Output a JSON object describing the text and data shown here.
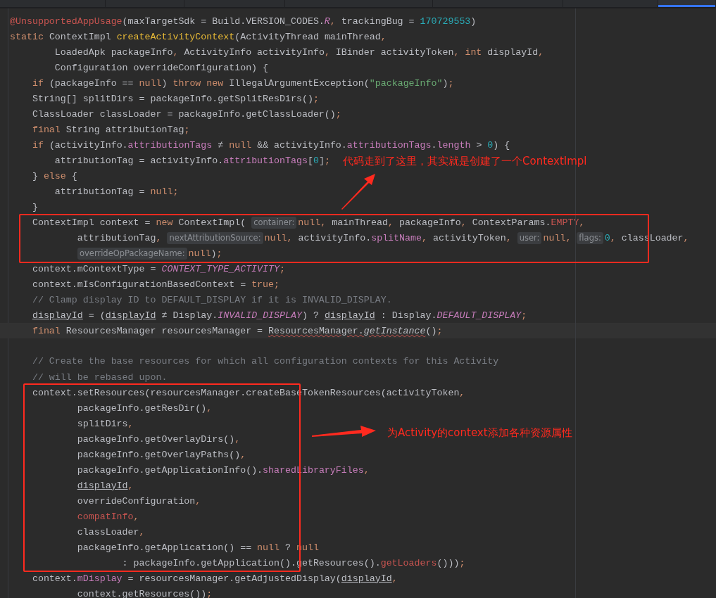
{
  "tabs": [
    {
      "selected": false
    },
    {
      "selected": false
    },
    {
      "selected": false
    },
    {
      "selected": false
    },
    {
      "selected": false
    },
    {
      "selected": false
    },
    {
      "selected": true
    }
  ],
  "lines": [
    {
      "tokens": [
        {
          "kind": "annotation",
          "text": "@UnsupportedAppUsage"
        },
        {
          "kind": "plain",
          "text": "(maxTargetSdk = Build.VERSION_CODES."
        },
        {
          "kind": "constant",
          "text": "R"
        },
        {
          "kind": "punct",
          "text": ","
        },
        {
          "kind": "plain",
          "text": " trackingBug = "
        },
        {
          "kind": "number",
          "text": "170729553"
        },
        {
          "kind": "plain",
          "text": ")"
        }
      ]
    },
    {
      "tokens": [
        {
          "kind": "keyword",
          "text": "static"
        },
        {
          "kind": "plain",
          "text": " ContextImpl "
        },
        {
          "kind": "method",
          "text": "createActivityContext"
        },
        {
          "kind": "plain",
          "text": "(ActivityThread mainThread"
        },
        {
          "kind": "punct",
          "text": ","
        }
      ]
    },
    {
      "tokens": [
        {
          "kind": "plain",
          "text": "        LoadedApk packageInfo"
        },
        {
          "kind": "punct",
          "text": ","
        },
        {
          "kind": "plain",
          "text": " ActivityInfo activityInfo"
        },
        {
          "kind": "punct",
          "text": ","
        },
        {
          "kind": "plain",
          "text": " IBinder activityToken"
        },
        {
          "kind": "punct",
          "text": ","
        },
        {
          "kind": "keyword",
          "text": " int"
        },
        {
          "kind": "plain",
          "text": " displayId"
        },
        {
          "kind": "punct",
          "text": ","
        }
      ]
    },
    {
      "tokens": [
        {
          "kind": "plain",
          "text": "        Configuration overrideConfiguration) {"
        }
      ]
    },
    {
      "tokens": [
        {
          "kind": "keyword",
          "text": "    if"
        },
        {
          "kind": "plain",
          "text": " (packageInfo == "
        },
        {
          "kind": "keyword",
          "text": "null"
        },
        {
          "kind": "plain",
          "text": ") "
        },
        {
          "kind": "keyword",
          "text": "throw new"
        },
        {
          "kind": "plain",
          "text": " IllegalArgumentException("
        },
        {
          "kind": "string",
          "text": "\"packageInfo\""
        },
        {
          "kind": "plain",
          "text": ")"
        },
        {
          "kind": "punct",
          "text": ";"
        }
      ]
    },
    {
      "tokens": [
        {
          "kind": "plain",
          "text": "    String[] splitDirs = packageInfo.getSplitResDirs()"
        },
        {
          "kind": "punct",
          "text": ";"
        }
      ]
    },
    {
      "tokens": [
        {
          "kind": "plain",
          "text": "    ClassLoader classLoader = packageInfo.getClassLoader()"
        },
        {
          "kind": "punct",
          "text": ";"
        }
      ]
    },
    {
      "tokens": [
        {
          "kind": "keyword",
          "text": "    final"
        },
        {
          "kind": "plain",
          "text": " String attributionTag"
        },
        {
          "kind": "punct",
          "text": ";"
        }
      ]
    },
    {
      "tokens": [
        {
          "kind": "keyword",
          "text": "    if"
        },
        {
          "kind": "plain",
          "text": " (activityInfo."
        },
        {
          "kind": "field",
          "text": "attributionTags"
        },
        {
          "kind": "plain",
          "text": " ≠ "
        },
        {
          "kind": "keyword",
          "text": "null"
        },
        {
          "kind": "plain",
          "text": " && activityInfo."
        },
        {
          "kind": "field",
          "text": "attributionTags"
        },
        {
          "kind": "plain",
          "text": "."
        },
        {
          "kind": "field",
          "text": "length"
        },
        {
          "kind": "plain",
          "text": " > "
        },
        {
          "kind": "number",
          "text": "0"
        },
        {
          "kind": "plain",
          "text": ") {"
        }
      ]
    },
    {
      "tokens": [
        {
          "kind": "plain",
          "text": "        attributionTag = activityInfo."
        },
        {
          "kind": "field",
          "text": "attributionTags"
        },
        {
          "kind": "plain",
          "text": "["
        },
        {
          "kind": "number",
          "text": "0"
        },
        {
          "kind": "plain",
          "text": "]"
        },
        {
          "kind": "punct",
          "text": ";"
        }
      ]
    },
    {
      "tokens": [
        {
          "kind": "plain",
          "text": "    } "
        },
        {
          "kind": "keyword",
          "text": "else"
        },
        {
          "kind": "plain",
          "text": " {"
        }
      ]
    },
    {
      "tokens": [
        {
          "kind": "plain",
          "text": "        attributionTag = "
        },
        {
          "kind": "keyword",
          "text": "null"
        },
        {
          "kind": "punct",
          "text": ";"
        }
      ]
    },
    {
      "tokens": [
        {
          "kind": "plain",
          "text": "    }"
        }
      ]
    },
    {
      "tokens": [
        {
          "kind": "plain",
          "text": "    ContextImpl context = "
        },
        {
          "kind": "keyword",
          "text": "new"
        },
        {
          "kind": "plain",
          "text": " ContextImpl("
        },
        {
          "kind": "hint",
          "text": "container:"
        },
        {
          "kind": "keyword",
          "text": "null"
        },
        {
          "kind": "punct",
          "text": ","
        },
        {
          "kind": "plain",
          "text": " mainThread"
        },
        {
          "kind": "punct",
          "text": ","
        },
        {
          "kind": "plain",
          "text": " packageInfo"
        },
        {
          "kind": "punct",
          "text": ","
        },
        {
          "kind": "plain",
          "text": " ContextParams."
        },
        {
          "kind": "error",
          "text": "EMPTY"
        },
        {
          "kind": "punct",
          "text": ","
        }
      ]
    },
    {
      "tokens": [
        {
          "kind": "plain",
          "text": "            attributionTag"
        },
        {
          "kind": "punct",
          "text": ","
        },
        {
          "kind": "hint",
          "text": "nextAttributionSource:"
        },
        {
          "kind": "keyword",
          "text": "null"
        },
        {
          "kind": "punct",
          "text": ","
        },
        {
          "kind": "plain",
          "text": " activityInfo."
        },
        {
          "kind": "field",
          "text": "splitName"
        },
        {
          "kind": "punct",
          "text": ","
        },
        {
          "kind": "plain",
          "text": " activityToken"
        },
        {
          "kind": "punct",
          "text": ","
        },
        {
          "kind": "hint",
          "text": "user:"
        },
        {
          "kind": "keyword",
          "text": "null"
        },
        {
          "kind": "punct",
          "text": ","
        },
        {
          "kind": "hint",
          "text": "flags:"
        },
        {
          "kind": "number",
          "text": "0"
        },
        {
          "kind": "punct",
          "text": ","
        },
        {
          "kind": "plain",
          "text": " classLoader"
        },
        {
          "kind": "punct",
          "text": ","
        }
      ]
    },
    {
      "continued": true,
      "tokens": [
        {
          "kind": "hint",
          "text": "overrideOpPackageName:"
        },
        {
          "kind": "keyword",
          "text": "null"
        },
        {
          "kind": "plain",
          "text": ")"
        },
        {
          "kind": "punct",
          "text": ";"
        }
      ]
    },
    {
      "tokens": [
        {
          "kind": "plain",
          "text": "    context.mContextType = "
        },
        {
          "kind": "constant",
          "text": "CONTEXT_TYPE_ACTIVITY"
        },
        {
          "kind": "punct",
          "text": ";"
        }
      ]
    },
    {
      "tokens": [
        {
          "kind": "plain",
          "text": "    context.mIsConfigurationBasedContext = "
        },
        {
          "kind": "keyword",
          "text": "true"
        },
        {
          "kind": "punct",
          "text": ";"
        }
      ]
    },
    {
      "tokens": [
        {
          "kind": "comment",
          "text": "    // Clamp display ID to DEFAULT_DISPLAY if it is INVALID_DISPLAY."
        }
      ]
    },
    {
      "tokens": [
        {
          "kind": "reassigned",
          "text": "    displayId"
        },
        {
          "kind": "plain",
          "text": " = ("
        },
        {
          "kind": "reassigned",
          "text": "displayId"
        },
        {
          "kind": "plain",
          "text": " ≠ Display."
        },
        {
          "kind": "constant",
          "text": "INVALID_DISPLAY"
        },
        {
          "kind": "plain",
          "text": ") ? "
        },
        {
          "kind": "reassigned",
          "text": "displayId"
        },
        {
          "kind": "plain",
          "text": " : Display."
        },
        {
          "kind": "constant",
          "text": "DEFAULT_DISPLAY"
        },
        {
          "kind": "punct",
          "text": ";"
        }
      ]
    },
    {
      "current": true,
      "tokens": [
        {
          "kind": "keyword",
          "text": "    final"
        },
        {
          "kind": "plain",
          "text": " ResourcesManager resourcesManager = "
        },
        {
          "kind": "typo",
          "text": "ResourcesManager."
        },
        {
          "kind": "typocall",
          "text": "getInstance"
        },
        {
          "kind": "plain",
          "text": "()"
        },
        {
          "kind": "punct",
          "text": ";"
        }
      ]
    },
    {
      "spaced": true,
      "tokens": [
        {
          "kind": "comment",
          "text": "    // Create the base resources for which all configuration contexts for this Activity"
        }
      ]
    },
    {
      "tokens": [
        {
          "kind": "comment",
          "text": "    // will be rebased upon."
        }
      ]
    },
    {
      "tokens": [
        {
          "kind": "plain",
          "text": "    context.setResources(resourcesManager.createBaseTokenResources(activityToken"
        },
        {
          "kind": "punct",
          "text": ","
        }
      ]
    },
    {
      "tokens": [
        {
          "kind": "plain",
          "text": "            packageInfo.getResDir()"
        },
        {
          "kind": "punct",
          "text": ","
        }
      ]
    },
    {
      "tokens": [
        {
          "kind": "plain",
          "text": "            splitDirs"
        },
        {
          "kind": "punct",
          "text": ","
        }
      ]
    },
    {
      "tokens": [
        {
          "kind": "plain",
          "text": "            packageInfo.getOverlayDirs()"
        },
        {
          "kind": "punct",
          "text": ","
        }
      ]
    },
    {
      "tokens": [
        {
          "kind": "plain",
          "text": "            packageInfo.getOverlayPaths()"
        },
        {
          "kind": "punct",
          "text": ","
        }
      ]
    },
    {
      "tokens": [
        {
          "kind": "plain",
          "text": "            packageInfo.getApplicationInfo()."
        },
        {
          "kind": "field",
          "text": "sharedLibraryFiles"
        },
        {
          "kind": "punct",
          "text": ","
        }
      ]
    },
    {
      "tokens": [
        {
          "kind": "reassigned",
          "text": "            displayId"
        },
        {
          "kind": "punct",
          "text": ","
        }
      ]
    },
    {
      "tokens": [
        {
          "kind": "plain",
          "text": "            overrideConfiguration"
        },
        {
          "kind": "punct",
          "text": ","
        }
      ]
    },
    {
      "tokens": [
        {
          "kind": "error",
          "text": "            compatInfo"
        },
        {
          "kind": "punct",
          "text": ","
        }
      ]
    },
    {
      "tokens": [
        {
          "kind": "plain",
          "text": "            classLoader"
        },
        {
          "kind": "punct",
          "text": ","
        }
      ]
    },
    {
      "tokens": [
        {
          "kind": "plain",
          "text": "            packageInfo.getApplication() == "
        },
        {
          "kind": "keyword",
          "text": "null"
        },
        {
          "kind": "plain",
          "text": " ? "
        },
        {
          "kind": "keyword",
          "text": "null"
        }
      ]
    },
    {
      "tokens": [
        {
          "kind": "plain",
          "text": "                    : packageInfo.getApplication().getResources()."
        },
        {
          "kind": "error",
          "text": "getLoaders"
        },
        {
          "kind": "plain",
          "text": "()))"
        },
        {
          "kind": "punct",
          "text": ";"
        }
      ]
    },
    {
      "tokens": [
        {
          "kind": "plain",
          "text": "    context."
        },
        {
          "kind": "field",
          "text": "mDisplay"
        },
        {
          "kind": "plain",
          "text": " = resourcesManager.getAdjustedDisplay("
        },
        {
          "kind": "reassigned",
          "text": "displayId"
        },
        {
          "kind": "punct",
          "text": ","
        }
      ]
    },
    {
      "tokens": [
        {
          "kind": "plain",
          "text": "            context.getResources())"
        },
        {
          "kind": "punct",
          "text": ";"
        }
      ]
    }
  ],
  "annotations": [
    {
      "text": "代码走到了这里，其实就是创建了一个ContextImpl"
    },
    {
      "text": "为Activity的context添加各种资源属性"
    }
  ]
}
